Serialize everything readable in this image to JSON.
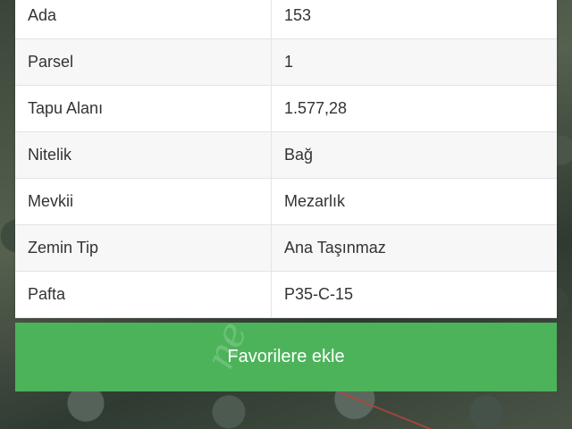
{
  "parcel_info": {
    "rows": [
      {
        "label": "Ada",
        "value": "153"
      },
      {
        "label": "Parsel",
        "value": "1"
      },
      {
        "label": "Tapu Alanı",
        "value": "1.577,28"
      },
      {
        "label": "Nitelik",
        "value": "Bağ"
      },
      {
        "label": "Mevkii",
        "value": "Mezarlık"
      },
      {
        "label": "Zemin Tip",
        "value": "Ana Taşınmaz"
      },
      {
        "label": "Pafta",
        "value": "P35-C-15"
      }
    ]
  },
  "actions": {
    "favorite_label": "Favorilere ekle"
  },
  "colors": {
    "button_green": "#4cb35a",
    "row_alt": "#f7f7f7"
  }
}
